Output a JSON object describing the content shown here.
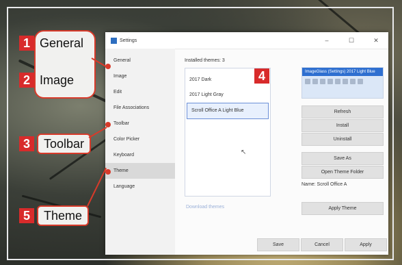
{
  "callouts": [
    {
      "num": "1",
      "label": "General"
    },
    {
      "num": "2",
      "label": "Image"
    },
    {
      "num": "3",
      "label": "Toolbar"
    },
    {
      "num": "4",
      "label": ""
    },
    {
      "num": "5",
      "label": "Theme"
    }
  ],
  "window": {
    "title": "Settings",
    "min": "–",
    "max": "☐",
    "close": "✕"
  },
  "sidebar": {
    "items": [
      "General",
      "Image",
      "Edit",
      "File Associations",
      "Toolbar",
      "Color Picker",
      "Keyboard",
      "Theme",
      "Language"
    ],
    "active": "Theme"
  },
  "themes": {
    "label": "Installed themes: 3",
    "items": [
      "2017 Dark",
      "2017 Light Gray",
      "Scroll Office A Light Blue"
    ],
    "selected": "Scroll Office A Light Blue",
    "download": "Download themes"
  },
  "preview": {
    "title": "ImageGlass (Settings) 2017 Light Blue"
  },
  "actions": {
    "refresh": "Refresh",
    "install": "Install",
    "uninstall": "Uninstall",
    "save_as": "Save As",
    "open_folder": "Open Theme Folder",
    "name": "Name: Scroll Office A",
    "apply_theme": "Apply Theme"
  },
  "footer": {
    "save": "Save",
    "cancel": "Cancel",
    "apply": "Apply"
  },
  "colors": {
    "accent": "#d82b2b",
    "selection": "#6b8fd6"
  }
}
